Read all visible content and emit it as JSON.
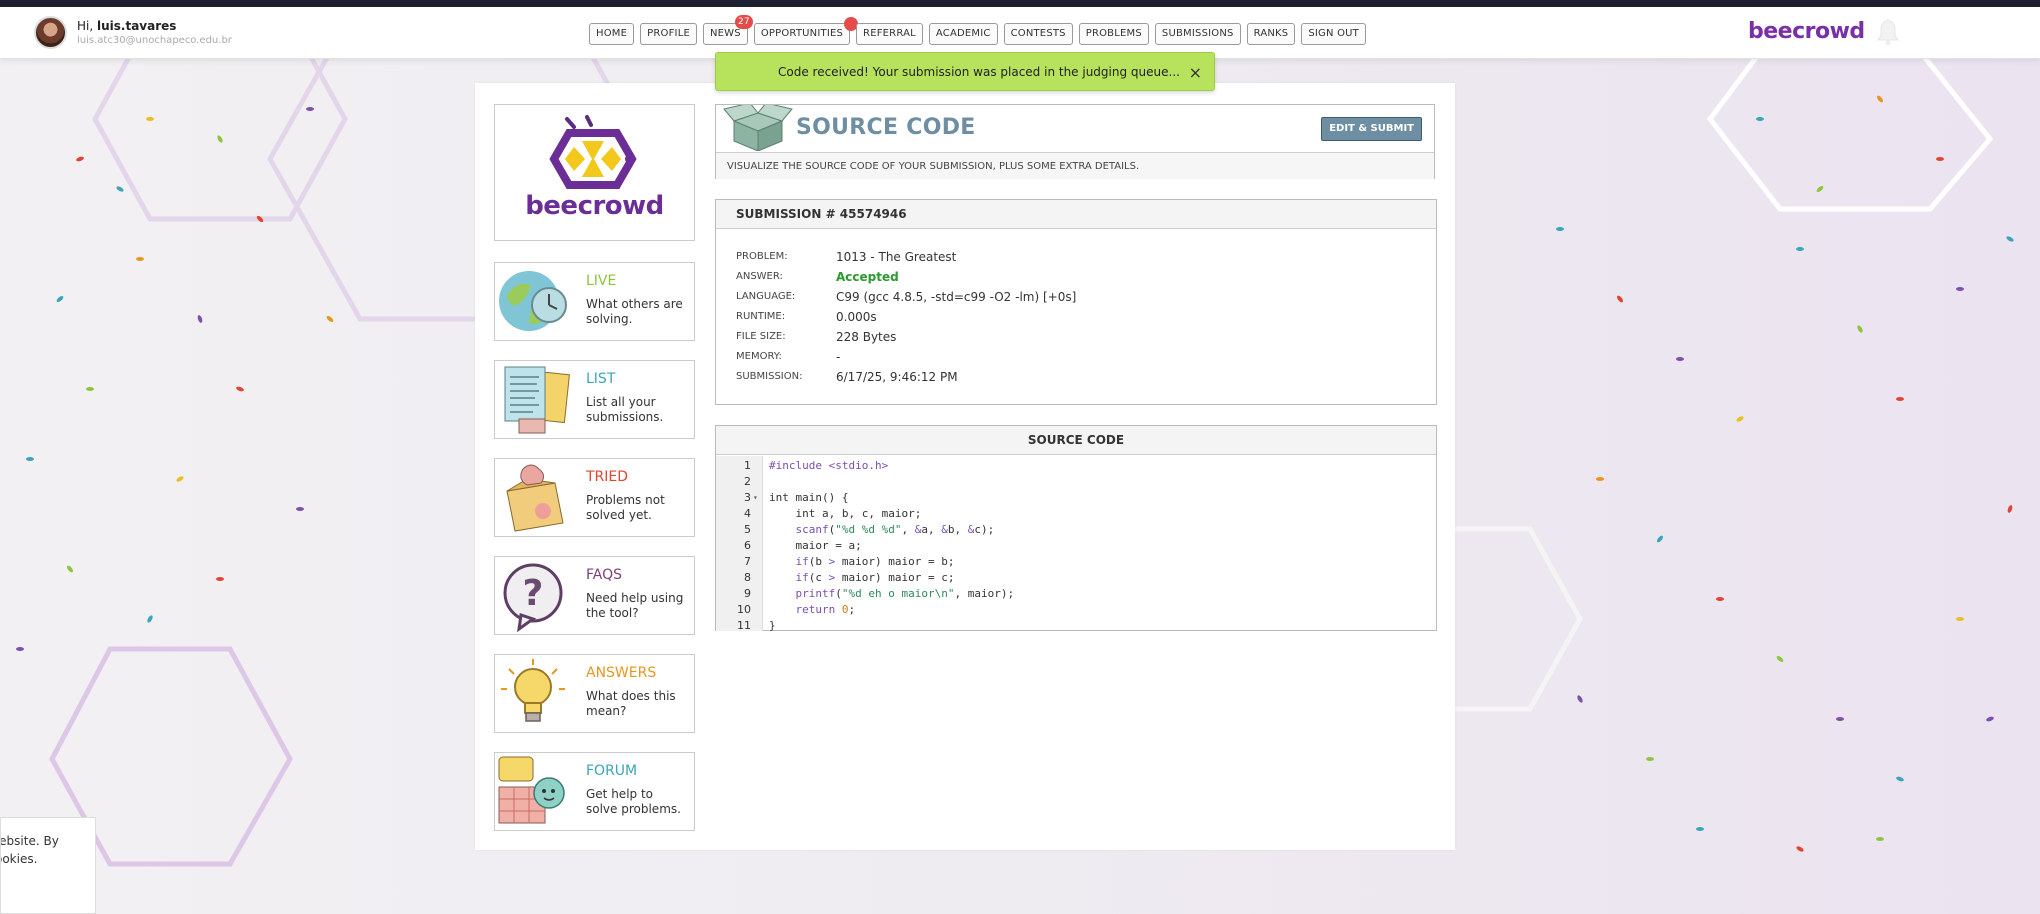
{
  "user": {
    "greeting": "Hi,",
    "username": "luis.tavares",
    "email": "luis.atc30@unochapeco.edu.br"
  },
  "menu": [
    {
      "label": "HOME"
    },
    {
      "label": "PROFILE"
    },
    {
      "label": "NEWS",
      "badge": "27"
    },
    {
      "label": "OPPORTUNITIES",
      "dot": true
    },
    {
      "label": "REFERRAL"
    },
    {
      "label": "ACADEMIC"
    },
    {
      "label": "CONTESTS"
    },
    {
      "label": "PROBLEMS"
    },
    {
      "label": "SUBMISSIONS"
    },
    {
      "label": "RANKS"
    },
    {
      "label": "SIGN OUT"
    }
  ],
  "brand": "beecrowd",
  "toast": {
    "message": "Code received! Your submission was placed in the judging queue...",
    "close": "×"
  },
  "logo_card": {
    "word": "beecrowd"
  },
  "side_cards": [
    {
      "title": "LIVE",
      "desc": "What others are solving.",
      "color": "#8cc63f",
      "icon": "globe-clock-icon"
    },
    {
      "title": "LIST",
      "desc": "List all your submissions.",
      "color": "#3aa6b9",
      "icon": "papers-icon"
    },
    {
      "title": "TRIED",
      "desc": "Problems not solved yet.",
      "color": "#e0452f",
      "icon": "trash-box-icon"
    },
    {
      "title": "FAQS",
      "desc": "Need help using the tool?",
      "color": "#7b3f7c",
      "icon": "question-bubble-icon"
    },
    {
      "title": "ANSWERS",
      "desc": "What does this mean?",
      "color": "#e8961e",
      "icon": "lightbulb-icon"
    },
    {
      "title": "FORUM",
      "desc": "Get help to solve problems.",
      "color": "#3aa6b9",
      "icon": "chat-bubbles-icon"
    }
  ],
  "source_header": {
    "title": "SOURCE CODE",
    "edit_button": "EDIT & SUBMIT",
    "subtitle": "VISUALIZE THE SOURCE CODE OF YOUR SUBMISSION, PLUS SOME EXTRA DETAILS."
  },
  "submission": {
    "title": "SUBMISSION # 45574946",
    "rows": [
      {
        "key": "PROBLEM:",
        "value": "1013 - The Greatest"
      },
      {
        "key": "ANSWER:",
        "value": "Accepted",
        "status": "ok"
      },
      {
        "key": "LANGUAGE:",
        "value": "C99 (gcc 4.8.5, -std=c99 -O2 -lm) [+0s]"
      },
      {
        "key": "RUNTIME:",
        "value": "0.000s"
      },
      {
        "key": "FILE SIZE:",
        "value": "228 Bytes"
      },
      {
        "key": "MEMORY:",
        "value": "-"
      },
      {
        "key": "SUBMISSION:",
        "value": "6/17/25, 9:46:12 PM"
      }
    ]
  },
  "code": {
    "title": "SOURCE CODE",
    "lines": [
      "#include <stdio.h>",
      "",
      "int main() {",
      "    int a, b, c, maior;",
      "    scanf(\"%d %d %d\", &a, &b, &c);",
      "    maior = a;",
      "    if(b > maior) maior = b;",
      "    if(c > maior) maior = c;",
      "    printf(\"%d eh o maior\\n\", maior);",
      "    return 0;",
      "}"
    ],
    "fold_line": 3
  },
  "cookie": {
    "line1": "ur website. By",
    "line2": "of cookies."
  }
}
